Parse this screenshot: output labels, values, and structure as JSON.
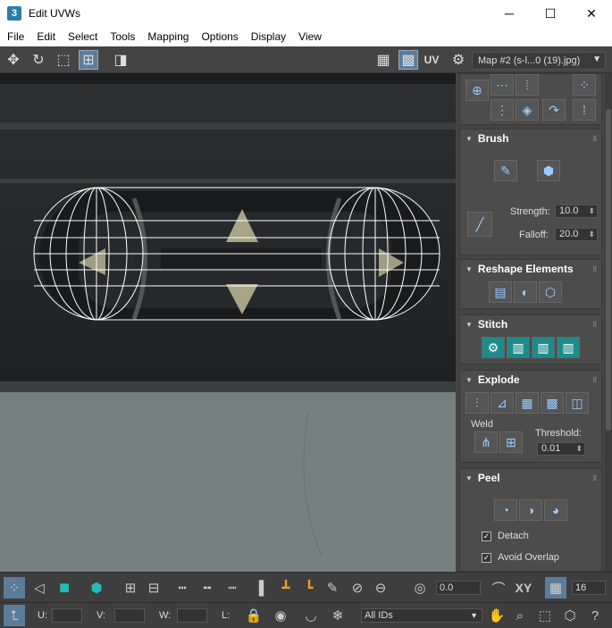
{
  "window": {
    "title": "Edit UVWs",
    "app_icon": "3",
    "minimize": "─",
    "maximize": "☐",
    "close": "✕"
  },
  "menu": [
    "File",
    "Edit",
    "Select",
    "Tools",
    "Mapping",
    "Options",
    "Display",
    "View"
  ],
  "toolbar": {
    "uv_label": "UV",
    "map_select": "Map #2 (s-l...0 (19).jpg)"
  },
  "brush": {
    "title": "Brush",
    "strength_label": "Strength:",
    "strength_value": "10.0",
    "falloff_label": "Falloff:",
    "falloff_value": "20.0"
  },
  "reshape": {
    "title": "Reshape Elements"
  },
  "stitch": {
    "title": "Stitch"
  },
  "explode": {
    "title": "Explode",
    "weld_label": "Weld",
    "threshold_label": "Threshold:",
    "threshold_value": "0.01"
  },
  "peel": {
    "title": "Peel",
    "detach_label": "Detach",
    "avoid_overlap_label": "Avoid Overlap"
  },
  "bottom": {
    "rotate_value": "0.0",
    "xy_label": "XY",
    "grid_value": "16",
    "u_label": "U:",
    "v_label": "V:",
    "w_label": "W:",
    "l_label": "L:",
    "ids_select": "All IDs"
  },
  "colors": {
    "accent": "#1e8b8b",
    "active_button": "#5b7d99"
  }
}
